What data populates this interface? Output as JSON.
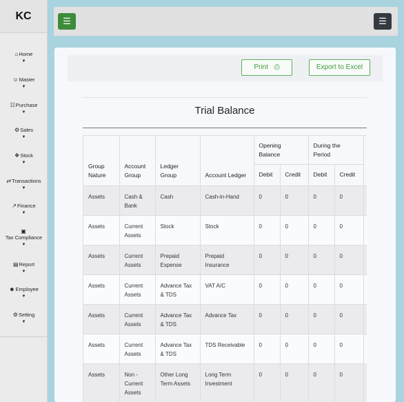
{
  "brand": "KC",
  "nav": [
    {
      "label": "Home",
      "icon": "home-icon",
      "glyph": "⌂"
    },
    {
      "label": "Master",
      "icon": "user-icon",
      "glyph": "☺"
    },
    {
      "label": "Purchase",
      "icon": "cart-icon",
      "glyph": "☷"
    },
    {
      "label": "Sales",
      "icon": "sales-icon",
      "glyph": "⚙"
    },
    {
      "label": "Stock",
      "icon": "cubes-icon",
      "glyph": "❖"
    },
    {
      "label": "Transactions",
      "icon": "exchange-icon",
      "glyph": "⇄"
    },
    {
      "label": "Finance",
      "icon": "chart-icon",
      "glyph": "↗"
    },
    {
      "label": "Tax Compliance",
      "icon": "money-icon",
      "glyph": "▣"
    },
    {
      "label": "Report",
      "icon": "report-icon",
      "glyph": "▤"
    },
    {
      "label": "Employee",
      "icon": "users-icon",
      "glyph": "☻"
    },
    {
      "label": "Setting",
      "icon": "cogs-icon",
      "glyph": "⚙"
    }
  ],
  "toolbar": {
    "print_label": "Print",
    "print_icon": "⎙",
    "export_label": "Export to Excel"
  },
  "report": {
    "title": "Trial Balance",
    "headers": {
      "group_nature": "Group Nature",
      "account_group": "Account Group",
      "ledger_group": "Ledger Group",
      "account_ledger": "Account Ledger",
      "opening_balance": "Opening Balance",
      "during_period": "During the Period",
      "debit": "Debit",
      "credit": "Credit"
    },
    "rows": [
      {
        "nature": "Assets",
        "group": "Cash & Bank",
        "ledger_group": "Cash",
        "ledger": "Cash-in-Hand",
        "ob_dr": "0",
        "ob_cr": "0",
        "dp_dr": "0",
        "dp_cr": "0"
      },
      {
        "nature": "Assets",
        "group": "Current Assets",
        "ledger_group": "Stock",
        "ledger": "Stock",
        "ob_dr": "0",
        "ob_cr": "0",
        "dp_dr": "0",
        "dp_cr": "0"
      },
      {
        "nature": "Assets",
        "group": "Current Assets",
        "ledger_group": "Prepaid Expense",
        "ledger": "Prepaid Insurance",
        "ob_dr": "0",
        "ob_cr": "0",
        "dp_dr": "0",
        "dp_cr": "0"
      },
      {
        "nature": "Assets",
        "group": "Current Assets",
        "ledger_group": "Advance Tax & TDS",
        "ledger": "VAT A/C",
        "ob_dr": "0",
        "ob_cr": "0",
        "dp_dr": "0",
        "dp_cr": "0"
      },
      {
        "nature": "Assets",
        "group": "Current Assets",
        "ledger_group": "Advance Tax & TDS",
        "ledger": "Advance Tax",
        "ob_dr": "0",
        "ob_cr": "0",
        "dp_dr": "0",
        "dp_cr": "0"
      },
      {
        "nature": "Assets",
        "group": "Current Assets",
        "ledger_group": "Advance Tax & TDS",
        "ledger": "TDS Receivable",
        "ob_dr": "0",
        "ob_cr": "0",
        "dp_dr": "0",
        "dp_cr": "0"
      },
      {
        "nature": "Assets",
        "group": "Non - Current Assets",
        "ledger_group": "Other Long Term Assets",
        "ledger": "Long Term Investment",
        "ob_dr": "0",
        "ob_cr": "0",
        "dp_dr": "0",
        "dp_cr": "0"
      }
    ]
  }
}
